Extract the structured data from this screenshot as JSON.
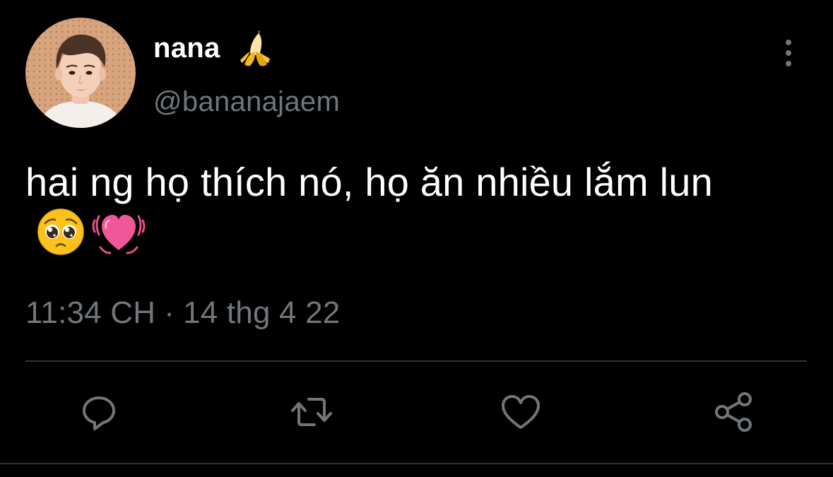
{
  "tweet": {
    "author": {
      "display_name": "nana",
      "name_emoji": "banana-emoji",
      "handle": "@bananajaem"
    },
    "text": "hai ng họ thích nó, họ ăn nhiều lắm lun",
    "text_emojis": [
      "pleading-face-emoji",
      "beating-heart-emoji"
    ],
    "time": "11:34 CH",
    "separator": "·",
    "date": "14 thg 4 22"
  },
  "actions": [
    {
      "name": "reply",
      "icon": "reply-icon"
    },
    {
      "name": "retweet",
      "icon": "retweet-icon"
    },
    {
      "name": "like",
      "icon": "heart-icon"
    },
    {
      "name": "share",
      "icon": "share-icon"
    }
  ],
  "colors": {
    "background": "#000000",
    "primary_text": "#ffffff",
    "secondary_text": "#71767b",
    "divider": "#2f3336"
  }
}
